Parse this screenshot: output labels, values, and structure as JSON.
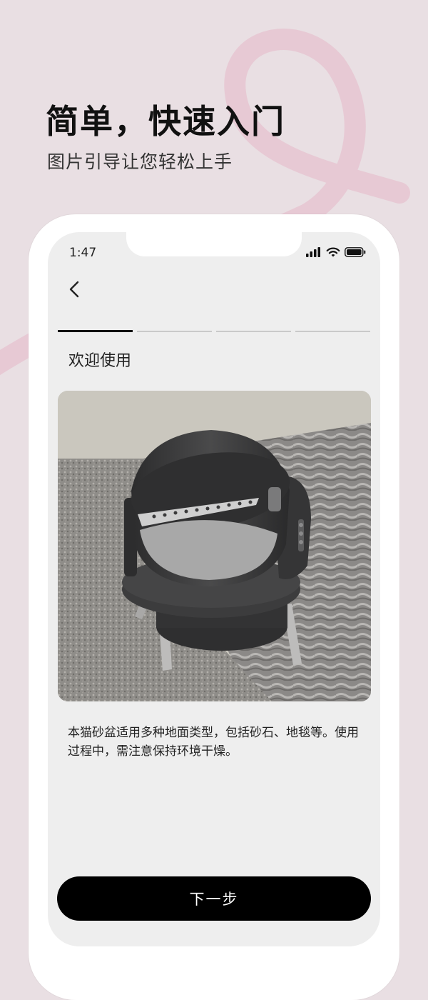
{
  "hero": {
    "title": "简单，快速入门",
    "subtitle": "图片引导让您轻松上手"
  },
  "status_bar": {
    "time": "1:47",
    "icons": [
      "signal-icon",
      "wifi-icon",
      "battery-icon"
    ]
  },
  "nav": {
    "back_icon": "chevron-left-icon"
  },
  "progress": {
    "total_steps": 4,
    "current_step": 1
  },
  "step": {
    "title": "欢迎使用",
    "image": "cat-litter-box-on-rug-photo",
    "description": "本猫砂盆适用多种地面类型，包括砂石、地毯等。使用过程中，需注意保持环境干燥。"
  },
  "actions": {
    "next_label": "下一步"
  },
  "colors": {
    "background": "#e9dfe3",
    "decoration": "#e8c5d0",
    "screen": "#eeeeee",
    "button": "#000000",
    "progress_active": "#111111",
    "progress_inactive": "#c9c9c9"
  }
}
